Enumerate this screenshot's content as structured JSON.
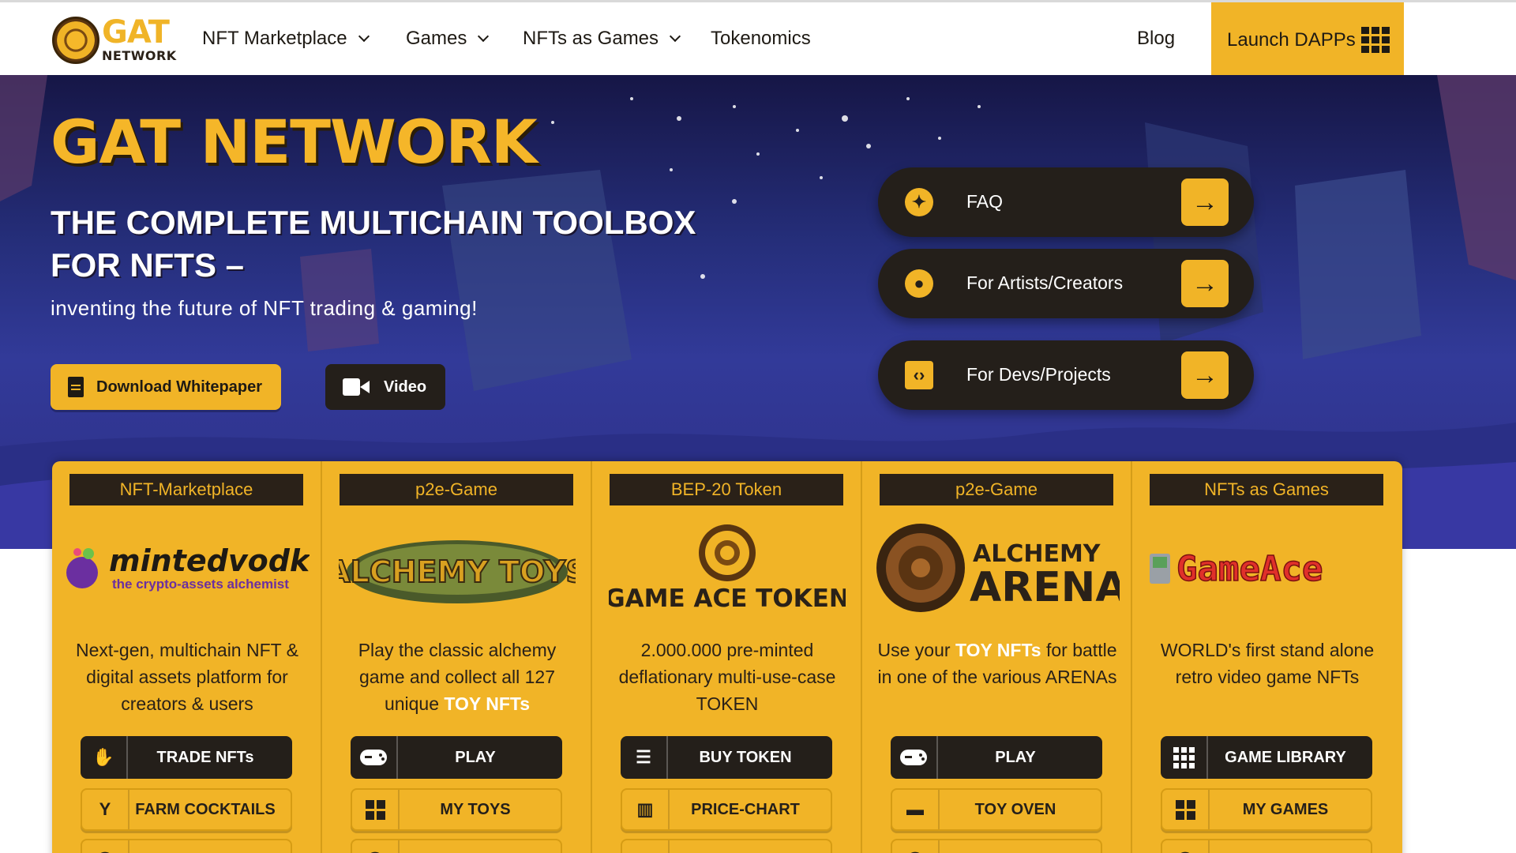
{
  "nav": {
    "logo_gat": "GAT",
    "logo_network": "NETWORK",
    "items": [
      "NFT Marketplace",
      "Games",
      "NFTs as Games",
      "Tokenomics"
    ],
    "blog": "Blog",
    "launch": "Launch DAPPs"
  },
  "hero": {
    "title": "GAT NETWORK",
    "subtitle": "THE COMPLETE MULTICHAIN TOOLBOX FOR NFTS –",
    "tagline": "inventing the future of NFT trading & gaming!",
    "whitepaper_label": "Download Whitepaper",
    "video_label": "Video",
    "pills": [
      {
        "label": "FAQ",
        "icon": "accessibility-icon"
      },
      {
        "label": "For Artists/Creators",
        "icon": "palette-icon"
      },
      {
        "label": "For Devs/Projects",
        "icon": "laptop-code-icon"
      }
    ]
  },
  "cards": [
    {
      "tag": "NFT-Marketplace",
      "logo_text": "mintedvodka",
      "logo_sub": "the crypto-assets alchemist",
      "desc": "Next-gen, multichain NFT & digital assets platform for creators & users",
      "desc_highlight": "",
      "desc_after": "",
      "btn1": "TRADE NFTs",
      "btn2": "FARM COCKTAILS"
    },
    {
      "tag": "p2e-Game",
      "logo_text": "ALCHEMY TOYS",
      "desc": "Play the classic alchemy game and collect all 127 unique ",
      "desc_highlight": "TOY NFTs",
      "desc_after": "",
      "btn1": "PLAY",
      "btn2": "MY TOYS"
    },
    {
      "tag": "BEP-20 Token",
      "logo_text": "GAME ACE TOKEN",
      "desc": "2.000.000 pre-minted deflationary multi-use-case TOKEN",
      "desc_highlight": "",
      "desc_after": "",
      "btn1": "BUY TOKEN",
      "btn2": "PRICE-CHART"
    },
    {
      "tag": "p2e-Game",
      "logo_text_1": "ALCHEMY",
      "logo_text_2": "ARENA",
      "desc": "Use your ",
      "desc_highlight": "TOY NFTs",
      "desc_after": " for battle in one of the various ARENAs",
      "btn1": "PLAY",
      "btn2": "TOY OVEN"
    },
    {
      "tag": "NFTs as Games",
      "logo_text": "GameAce",
      "desc": "WORLD's first stand alone retro video game NFTs",
      "desc_highlight": "",
      "desc_after": "",
      "btn1": "GAME LIBRARY",
      "btn2": "MY GAMES"
    }
  ],
  "colors": {
    "accent": "#f1b427",
    "dark": "#241f1a",
    "hero_bg": "#2e3490"
  }
}
